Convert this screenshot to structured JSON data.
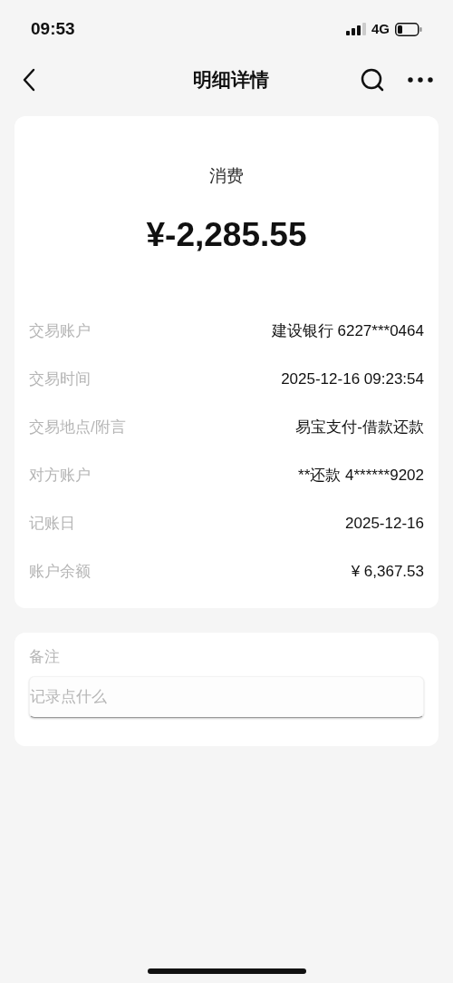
{
  "status_bar": {
    "time": "09:53",
    "network": "4G"
  },
  "nav": {
    "title": "明细详情"
  },
  "summary": {
    "type": "消费",
    "amount": "¥-2,285.55"
  },
  "details": [
    {
      "label": "交易账户",
      "value": "建设银行 6227***0464"
    },
    {
      "label": "交易时间",
      "value": "2025-12-16 09:23:54"
    },
    {
      "label": "交易地点/附言",
      "value": "易宝支付-借款还款"
    },
    {
      "label": "对方账户",
      "value": "**还款 4******9202"
    },
    {
      "label": "记账日",
      "value": "2025-12-16"
    },
    {
      "label": "账户余额",
      "value": "¥ 6,367.53"
    }
  ],
  "note": {
    "label": "备注",
    "placeholder": "记录点什么"
  }
}
